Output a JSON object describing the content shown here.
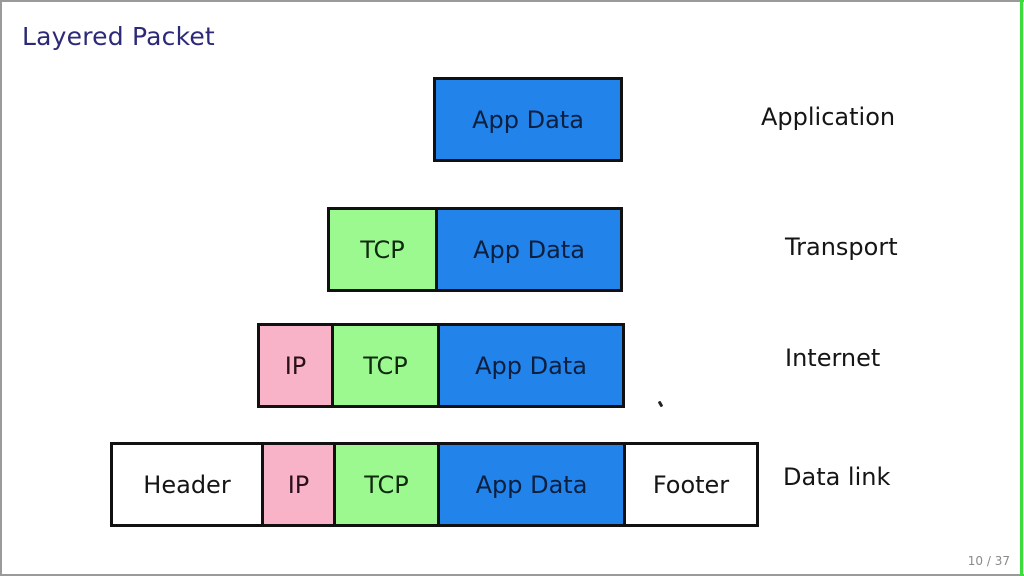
{
  "slide": {
    "title": "Layered Packet",
    "page_current": "10",
    "page_total": "37",
    "page_label": "10 / 37"
  },
  "colors": {
    "title": "#2c2a78",
    "app_data": "#2283ea",
    "tcp": "#9cf990",
    "ip": "#f9b3c8",
    "header_footer": "#ffffff",
    "border": "#111111"
  },
  "layers": [
    {
      "name": "Application",
      "segments": [
        "App Data"
      ]
    },
    {
      "name": "Transport",
      "segments": [
        "TCP",
        "App Data"
      ]
    },
    {
      "name": "Internet",
      "segments": [
        "IP",
        "TCP",
        "App Data"
      ]
    },
    {
      "name": "Data link",
      "segments": [
        "Header",
        "IP",
        "TCP",
        "App Data",
        "Footer"
      ]
    }
  ]
}
